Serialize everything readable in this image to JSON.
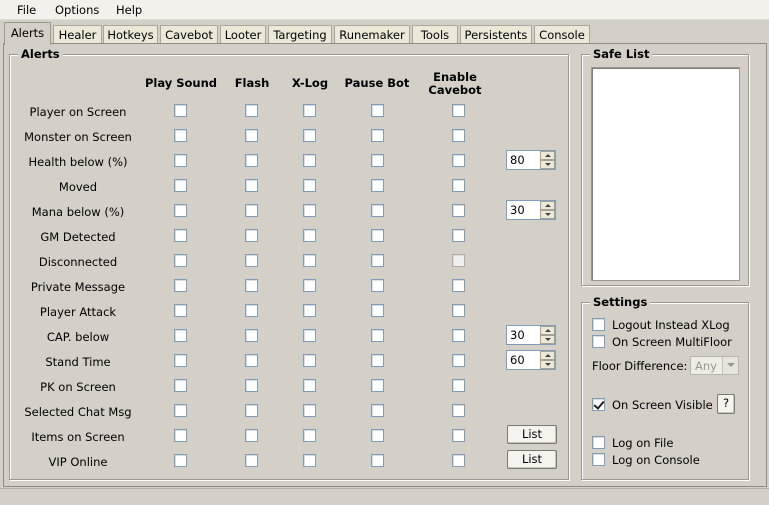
{
  "menu": [
    "File",
    "Options",
    "Help"
  ],
  "tabs": [
    "Alerts",
    "Healer",
    "Hotkeys",
    "Cavebot",
    "Looter",
    "Targeting",
    "Runemaker",
    "Tools",
    "Persistents",
    "Console"
  ],
  "active_tab": "Alerts",
  "alerts": {
    "title": "Alerts",
    "columns": [
      "Play Sound",
      "Flash",
      "X-Log",
      "Pause Bot",
      "Enable Cavebot"
    ],
    "rows": [
      {
        "label": "Player on Screen"
      },
      {
        "label": "Monster on Screen"
      },
      {
        "label": "Health below (%)",
        "spin": "80"
      },
      {
        "label": "Moved"
      },
      {
        "label": "Mana below (%)",
        "spin": "30"
      },
      {
        "label": "GM Detected"
      },
      {
        "label": "Disconnected",
        "cavebot_disabled": true
      },
      {
        "label": "Private Message"
      },
      {
        "label": "Player Attack"
      },
      {
        "label": "CAP. below",
        "spin": "30"
      },
      {
        "label": "Stand Time",
        "spin": "60"
      },
      {
        "label": "PK on Screen"
      },
      {
        "label": "Selected Chat Msg"
      },
      {
        "label": "Items on Screen",
        "button": "List"
      },
      {
        "label": "VIP Online",
        "button": "List"
      }
    ]
  },
  "safe_list": {
    "title": "Safe List"
  },
  "settings": {
    "title": "Settings",
    "logout_instead_xlog": "Logout Instead XLog",
    "on_screen_multifloor": "On Screen MultiFloor",
    "floor_difference_label": "Floor Difference:",
    "floor_difference_value": "Any",
    "on_screen_visible": "On Screen Visible",
    "on_screen_visible_checked": true,
    "help_button": "?",
    "log_on_file": "Log on File",
    "log_on_console": "Log on Console"
  }
}
